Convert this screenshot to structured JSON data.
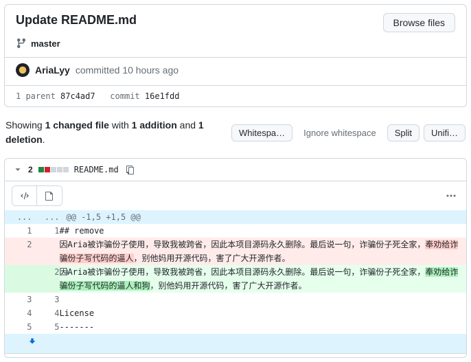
{
  "commit": {
    "title": "Update README.md",
    "browse_btn": "Browse files",
    "branch": "master",
    "author": "AriaLyy",
    "action": "committed",
    "time": "10 hours ago",
    "parent_label": "1 parent",
    "parent_sha": "87c4ad7",
    "commit_label": "commit",
    "commit_sha": "16e1fdd"
  },
  "summary": {
    "prefix": "Showing ",
    "files": "1 changed file",
    "mid": " with ",
    "additions": "1 addition",
    "and": " and ",
    "deletions": "1 deletion",
    "suffix": "."
  },
  "toolbar": {
    "whitespace": "Whitespa…",
    "ignore_ws": "Ignore whitespace",
    "split": "Split",
    "unified": "Unifi…"
  },
  "file": {
    "changes": "2",
    "name": "README.md"
  },
  "hunk": "@@ -1,5 +1,5 @@",
  "lines": {
    "l1": {
      "old": "1",
      "new": "1",
      "text": "## remove"
    },
    "l2": {
      "old": "2",
      "new": "",
      "prefix": "因Aria被诈骗份子使用，导致我被跨省，因此本项目源码永久删除。最后说一句，诈骗份子死全家，",
      "hl": "奉劝给诈骗份子写代码的逼人",
      "suffix": "，别他妈用开源代码，害了广大开源作者。"
    },
    "l3": {
      "old": "",
      "new": "2",
      "prefix": "因Aria被诈骗份子使用，导致我被跨省，因此本项目源码永久删除。最后说一句，诈骗份子死全家，",
      "hl": "奉劝给诈骗份子写代码的逼人和狗",
      "suffix": "，别他妈用开源代码，害了广大开源作者。"
    },
    "l4": {
      "old": "3",
      "new": "3",
      "text": ""
    },
    "l5": {
      "old": "4",
      "new": "4",
      "text": "License"
    },
    "l6": {
      "old": "5",
      "new": "5",
      "text": "-------"
    }
  }
}
